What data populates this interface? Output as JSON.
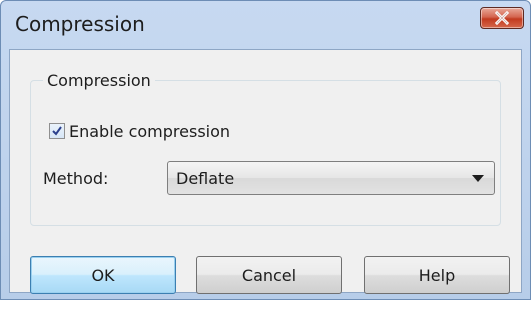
{
  "window": {
    "title": "Compression"
  },
  "group": {
    "legend": "Compression",
    "enable_label": "Enable compression",
    "enable_checked": true,
    "method_label": "Method:",
    "method_value": "Deflate"
  },
  "buttons": {
    "ok": "OK",
    "cancel": "Cancel",
    "help": "Help"
  },
  "colors": {
    "close_button": "#c23a1f",
    "default_button_border": "#3c7fb1",
    "dialog_background": "#f0f0f0"
  },
  "icons": {
    "close": "close-icon",
    "check": "checkmark-icon",
    "dropdown": "chevron-down-icon"
  }
}
